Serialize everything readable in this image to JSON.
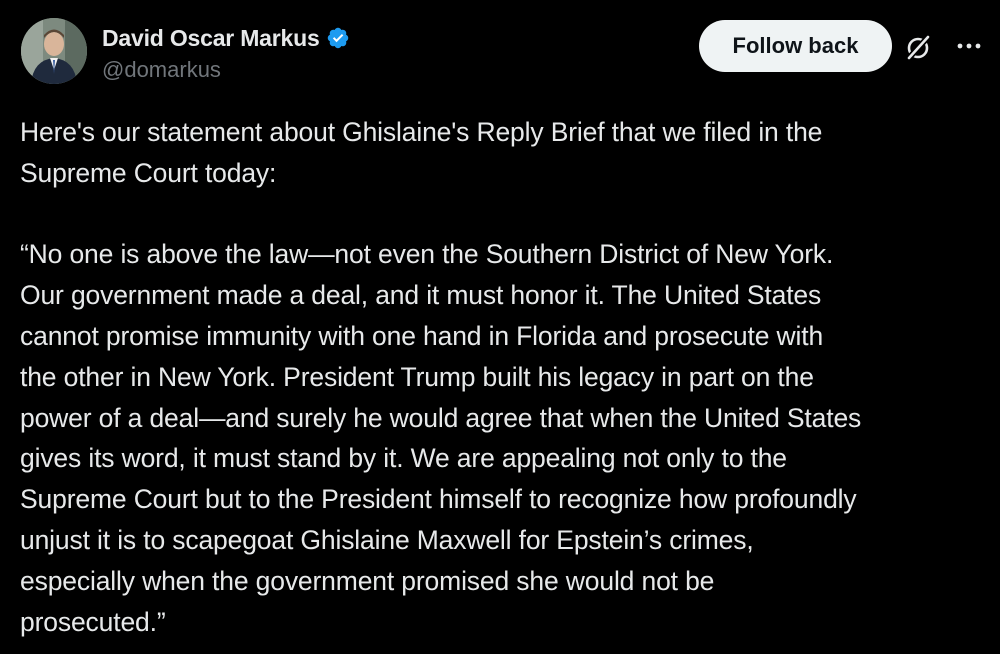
{
  "author": {
    "display_name": "David Oscar Markus",
    "handle": "@domarkus",
    "avatar_icon": "person-photo-avatar",
    "verified_icon": "verified-badge-icon",
    "verified_color": "#1d9bf0"
  },
  "actions": {
    "follow_label": "Follow back",
    "grok_icon": "grok-icon",
    "more_icon": "more-options-icon"
  },
  "tweet": {
    "paragraph1": "Here's our statement about Ghislaine's Reply Brief that we filed in the\nSupreme Court today:",
    "paragraph2": "“No one is above the law—not even the Southern District of New York.\nOur government made a deal, and it must honor it. The United States\ncannot promise immunity with one hand in Florida and prosecute with\nthe other in New York. President Trump built his legacy in part on the\npower of a deal—and surely he would agree that when the United States\ngives its word, it must stand by it. We are appealing not only to the\nSupreme Court but to the President himself to recognize how profoundly\nunjust it is to scapegoat Ghislaine Maxwell for Epstein’s crimes,\nespecially when the government promised she would not be\nprosecuted.”"
  },
  "colors": {
    "background": "#000000",
    "text_primary": "#e7e9ea",
    "text_secondary": "#71767b",
    "button_bg": "#eff3f4",
    "button_text": "#0f1419"
  }
}
